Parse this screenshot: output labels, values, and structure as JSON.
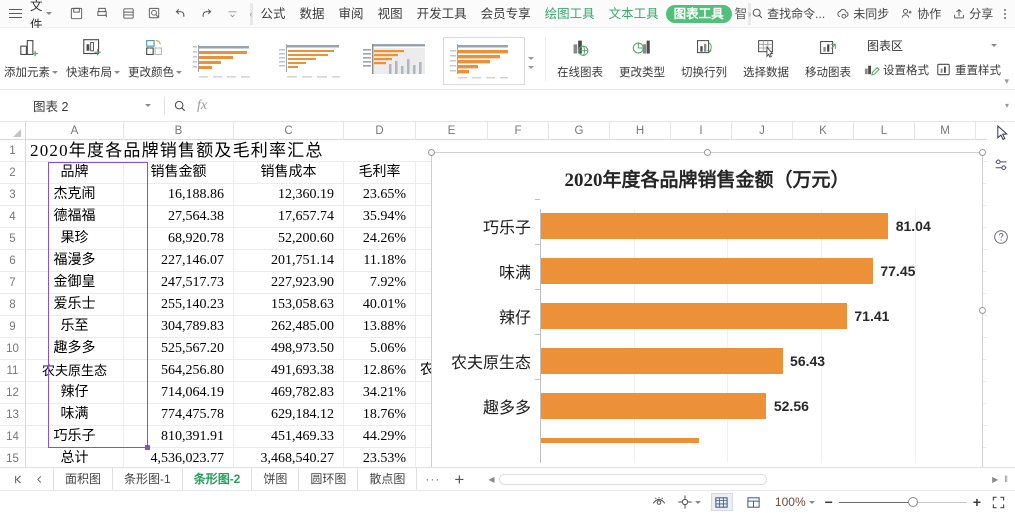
{
  "topbar": {
    "menu_icon": "hamburger-icon",
    "file_label": "文件",
    "quick_access": [
      {
        "name": "save-icon"
      },
      {
        "name": "print-icon"
      },
      {
        "name": "print-preview-icon"
      },
      {
        "name": "find-icon"
      },
      {
        "name": "undo-icon"
      },
      {
        "name": "redo-icon"
      },
      {
        "name": "customize-qat-icon"
      }
    ],
    "scroll_left": "‹",
    "scroll_right": "›",
    "tabs": [
      {
        "label": "公式",
        "state": "normal"
      },
      {
        "label": "数据",
        "state": "normal"
      },
      {
        "label": "审阅",
        "state": "normal"
      },
      {
        "label": "视图",
        "state": "normal"
      },
      {
        "label": "开发工具",
        "state": "normal"
      },
      {
        "label": "会员专享",
        "state": "normal"
      },
      {
        "label": "绘图工具",
        "state": "green"
      },
      {
        "label": "文本工具",
        "state": "green"
      },
      {
        "label": "图表工具",
        "state": "active"
      },
      {
        "label": "智",
        "state": "clipped"
      }
    ],
    "search_placeholder": "查找命令...",
    "search_icon": "search-icon",
    "sync_label": "未同步",
    "sync_icon": "cloud-sync-icon",
    "collab_label": "协作",
    "collab_icon": "user-add-icon",
    "share_label": "分享",
    "share_icon": "share-upload-icon",
    "more_icon": "more-vertical-icon",
    "collapse_icon": "chevron-up-icon"
  },
  "ribbon": {
    "buttons": [
      {
        "label": "添加元素",
        "icon": "add-chart-element-icon",
        "dropdown": true
      },
      {
        "label": "快速布局",
        "icon": "quick-layout-icon",
        "dropdown": true
      },
      {
        "label": "更改颜色",
        "icon": "change-colors-icon",
        "dropdown": true
      }
    ],
    "gallery_label": "chart-style-gallery",
    "gallery_count": 6,
    "gallery_selected_index": 3,
    "tools": [
      {
        "label": "在线图表",
        "icon": "online-chart-icon"
      },
      {
        "label": "更改类型",
        "icon": "change-chart-type-icon"
      },
      {
        "label": "切换行列",
        "icon": "switch-row-column-icon"
      },
      {
        "label": "选择数据",
        "icon": "select-data-icon"
      },
      {
        "label": "移动图表",
        "icon": "move-chart-icon"
      }
    ],
    "chart_area_select": "图表区",
    "format_label": "设置格式",
    "format_icon": "format-paint-icon",
    "reset_label": "重置样式",
    "reset_icon": "reset-style-icon"
  },
  "formula_bar": {
    "name_box_value": "图表 2",
    "name_box_caret": "▾",
    "search_icon": "search-icon",
    "fx_icon": "fx-icon",
    "formula_value": "",
    "expand_icon": "chevron-down-icon"
  },
  "grid": {
    "columns": [
      "A",
      "B",
      "C",
      "D",
      "E",
      "F",
      "G",
      "H",
      "I",
      "J",
      "K",
      "L",
      "M"
    ],
    "title_row": {
      "row": "1",
      "text": "2020年度各品牌销售额及毛利率汇总"
    },
    "headers": {
      "row": "2",
      "cells": [
        "品牌",
        "销售金额",
        "销售成本",
        "毛利率"
      ]
    },
    "rows": [
      {
        "row": "3",
        "brand": "杰克闹",
        "amount": "16,188.86",
        "cost": "12,360.19",
        "margin": "23.65%"
      },
      {
        "row": "4",
        "brand": "德福福",
        "amount": "27,564.38",
        "cost": "17,657.74",
        "margin": "35.94%"
      },
      {
        "row": "5",
        "brand": "果珍",
        "amount": "68,920.78",
        "cost": "52,200.60",
        "margin": "24.26%"
      },
      {
        "row": "6",
        "brand": "福漫多",
        "amount": "227,146.07",
        "cost": "201,751.14",
        "margin": "11.18%"
      },
      {
        "row": "7",
        "brand": "金御皇",
        "amount": "247,517.73",
        "cost": "227,923.90",
        "margin": "7.92%"
      },
      {
        "row": "8",
        "brand": "爱乐士",
        "amount": "255,140.23",
        "cost": "153,058.63",
        "margin": "40.01%"
      },
      {
        "row": "9",
        "brand": "乐至",
        "amount": "304,789.83",
        "cost": "262,485.00",
        "margin": "13.88%"
      },
      {
        "row": "10",
        "brand": "趣多多",
        "amount": "525,567.20",
        "cost": "498,973.50",
        "margin": "5.06%"
      },
      {
        "row": "11",
        "brand": "农夫原生态",
        "amount": "564,256.80",
        "cost": "491,693.38",
        "margin": "12.86%"
      },
      {
        "row": "12",
        "brand": "辣仔",
        "amount": "714,064.19",
        "cost": "469,782.83",
        "margin": "34.21%"
      },
      {
        "row": "13",
        "brand": "味满",
        "amount": "774,475.78",
        "cost": "629,184.12",
        "margin": "18.76%"
      },
      {
        "row": "14",
        "brand": "巧乐子",
        "amount": "810,391.91",
        "cost": "451,469.33",
        "margin": "44.29%"
      },
      {
        "row": "15",
        "brand": "总计",
        "amount": "4,536,023.77",
        "cost": "3,468,540.27",
        "margin": "23.53%"
      }
    ],
    "overflow_text": "农"
  },
  "chart_data": {
    "type": "bar",
    "title": "2020年度各品牌销售金额（万元）",
    "xlabel": "",
    "ylabel": "",
    "orientation": "horizontal",
    "categories": [
      "趣多多",
      "农夫原生态",
      "辣仔",
      "味满",
      "巧乐子"
    ],
    "values": [
      52.56,
      56.43,
      71.41,
      77.45,
      81.04
    ],
    "labels": [
      "52.56",
      "56.43",
      "71.41",
      "77.45",
      "81.04"
    ],
    "bar_color": "#ED9138",
    "xlim": [
      0,
      90
    ],
    "grid": true,
    "legend": false,
    "clipped_bottom_category": true
  },
  "sheet_tabs": {
    "nav_first_icon": "first-sheet-icon",
    "nav_prev_icon": "prev-sheet-icon",
    "tabs": [
      {
        "label": "面积图",
        "active": false
      },
      {
        "label": "条形图-1",
        "active": false
      },
      {
        "label": "条形图-2",
        "active": true
      },
      {
        "label": "饼图",
        "active": false
      },
      {
        "label": "圆环图",
        "active": false
      },
      {
        "label": "散点图",
        "active": false
      }
    ],
    "more_icon": "more-sheets-icon",
    "add_label": "+",
    "scroll_left_icon": "scroll-left-icon",
    "scroll_right_icon": "scroll-right-icon"
  },
  "status_bar": {
    "eye_icon": "eye-icon",
    "pan_icon": "pan-icon",
    "view_normal_icon": "normal-view-icon",
    "view_page_icon": "page-layout-icon",
    "zoom_label": "100%",
    "zoom_caret": "▾",
    "zoom_minus": "−",
    "zoom_plus": "+",
    "fullscreen_icon": "fullscreen-icon"
  },
  "right_rail": {
    "cursor_icon": "cursor-arrow-icon",
    "items": [
      {
        "name": "chart-settings-icon"
      },
      {
        "name": "help-icon"
      }
    ]
  }
}
